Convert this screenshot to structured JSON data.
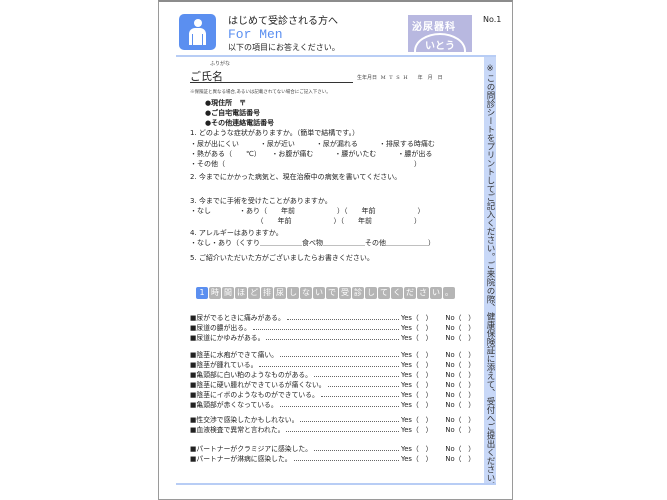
{
  "header": {
    "title": "はじめて受診される方へ",
    "subtitle": "For Men",
    "instruction": "以下の項目にお答えください。",
    "page_no": "No.1",
    "logo_top": "泌尿器科",
    "logo_bottom": "いとう",
    "icon": "man-icon"
  },
  "side_note": "※この問診シートをプリントしてご記入ください。ご来院の際、健康保険証に添えて、受付へご提出ください。",
  "personal": {
    "furigana": "ふりがな",
    "name_label": "ご氏名",
    "dob_label": "生年月日 M T S H　　年　月　日",
    "note": "※保険証と異なる場合,あるいは記載されてない場合にご記入下さい。",
    "contacts": [
      "●現住所　〒",
      "●ご自宅電話番号",
      "●その他連絡電話番号"
    ]
  },
  "questions": [
    {
      "text": "1. どのような症状がありますか。（簡単で結構です。）"
    },
    {
      "text": "・尿が出にくい　　　・尿が近い　　　・尿が漏れる　　　・排尿する時痛む"
    },
    {
      "text": "・熱がある（　　℃）　　・お腹が痛む　　　・腰がいたむ　　　・膿が出る"
    },
    {
      "text": "・その他（　　　　　　　　　　　　　　　　　　　　　　　　　　　）"
    },
    {
      "text": "2. 今までにかかった病気と、現在治療中の病気を書いてください。"
    },
    {
      "text": "3. 今までに手術を受けたことがありますか。"
    },
    {
      "text": "・なし　　　　・あり（　　年前　　　　　　）（　　年前　　　　　　）"
    },
    {
      "text": "　　　　　　　　　　（　　年前　　　　　　）（　　年前　　　　　　）"
    },
    {
      "text": "4. アレルギーはありますか。"
    },
    {
      "text": "・なし・あり（くすり＿＿＿＿＿＿食べ物＿＿＿＿＿＿その他＿＿＿＿＿＿）"
    },
    {
      "text": "5. ご紹介いただいた方がございましたらお書きください。"
    }
  ],
  "banner": {
    "chars": [
      "1",
      "時",
      "間",
      "ほ",
      "ど",
      "排",
      "尿",
      "し",
      "な",
      "い",
      "で",
      "受",
      "診",
      "し",
      "て",
      "く",
      "だ",
      "さ",
      "い",
      "。"
    ]
  },
  "checklist": {
    "yes_label": "Yes（　）",
    "no_label": "No（　）",
    "groups": [
      [
        "■尿がでるときに痛みがある。",
        "■尿道の膿が出る。",
        "■尿道にかゆみがある。"
      ],
      [
        "■陰茎に水疱ができて痛い。",
        "■陰茎が腫れている。",
        "■亀頭部に白い粕のようなものがある。",
        "■陰茎に硬い腫れができているが痛くない。",
        "■陰茎にイボのようなものができている。",
        "■亀頭部が赤くなっている。"
      ],
      [
        "■性交渉で感染したかもしれない。",
        "■血液検査で異常と言われた。"
      ],
      [
        "■パートナーがクラミジアに感染した。",
        "■パートナーが淋病に感染した。"
      ]
    ]
  },
  "colors": {
    "accent": "#5b8ff0",
    "sidebar": "#c8d8f8",
    "logo_bg": "#b8b8e0"
  }
}
